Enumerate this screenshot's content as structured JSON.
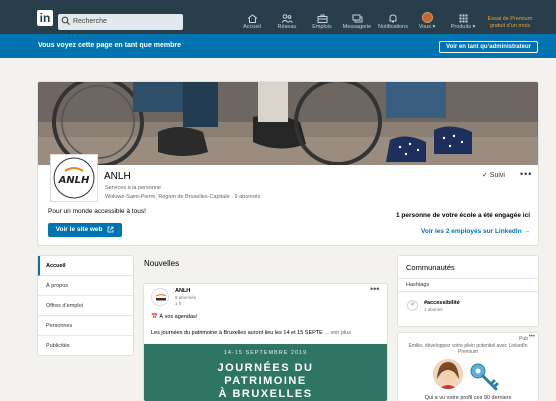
{
  "nav": {
    "logo": "in",
    "search_placeholder": "Recherche",
    "items": [
      {
        "label": "Accueil",
        "icon": "home-icon"
      },
      {
        "label": "Réseau",
        "icon": "network-icon"
      },
      {
        "label": "Emplois",
        "icon": "briefcase-icon"
      },
      {
        "label": "Messagerie",
        "icon": "messaging-icon"
      },
      {
        "label": "Notifications",
        "icon": "bell-icon"
      },
      {
        "label": "Vous ▾",
        "icon": "avatar"
      },
      {
        "label": "Produits ▾",
        "icon": "grid-icon"
      }
    ],
    "premium_line1": "Essai de Premium",
    "premium_line2": "gratuit d’un mois"
  },
  "banner": {
    "text": "Vous voyez cette page en tant que membre",
    "button": "Voir en tant qu’administrateur"
  },
  "company": {
    "name": "ANLH",
    "category": "Services à la personne",
    "location_followers": "Woluwe-Saint-Pierre, Région de Bruxelles-Capitale · 9 abonnés",
    "tagline": "Pour un monde accessible à tous!",
    "site_button": "Voir le site web",
    "follow_status": "✓ Suivi",
    "more": "•••",
    "school_text": "1 personne de votre école a été engagée ici",
    "employees_link": "Voir les 2 employés sur LinkedIn →"
  },
  "left_nav": [
    "Accueil",
    "À propos",
    "Offres d’emploi",
    "Personnes",
    "Publicités"
  ],
  "news": {
    "heading": "Nouvelles",
    "post": {
      "author": "ANLH",
      "followers": "9 abonnés",
      "time": "1 h",
      "line1": "📅 À vos agendas!",
      "line2": "Les journées du patrimoine à Bruxelles auront lieu les 14 et 15 SEPTE",
      "see_more": "... voir plus",
      "image_date": "14-15 SEPTEMBRE 2019",
      "image_title_1": "JOURNÉES DU",
      "image_title_2": "PATRIMOINE",
      "image_title_3": "À BRUXELLES",
      "more": "•••"
    }
  },
  "communities": {
    "heading": "Communautés",
    "tab": "Hashtags",
    "hashtag": "#accessibilité",
    "hashtag_followers": "1 abonné"
  },
  "ad": {
    "label": "Pub",
    "dots": "•••",
    "text": "Emilie, développez votre plein potentiel avec LinkedIn Premium",
    "bottom": "Qui a vu votre profil ces 90 derniers"
  },
  "colors": {
    "nav_bg": "#283e4a",
    "accent": "#0073b1",
    "premium": "#e7a33e",
    "post_image_bg": "#2e7663"
  }
}
